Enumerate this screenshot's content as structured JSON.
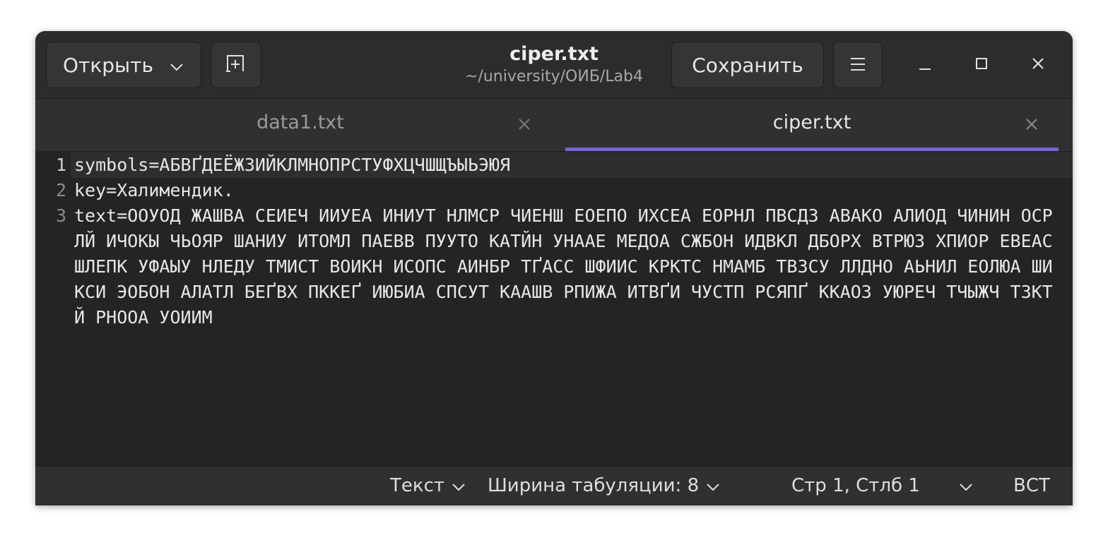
{
  "header": {
    "open_label": "Открыть",
    "title": "ciper.txt",
    "subtitle": "~/university/ОИБ/Lab4",
    "save_label": "Сохранить"
  },
  "tabs": [
    {
      "label": "data1.txt",
      "active": false
    },
    {
      "label": "ciper.txt",
      "active": true
    }
  ],
  "editor": {
    "line_numbers": [
      "1",
      "2",
      "3"
    ],
    "lines": [
      "symbols=АБВҐДЕЁЖЗИЙКЛМНОПРСТУФХЦЧШЩЪЫЬЭЮЯ",
      "key=Халимендик.",
      "text=ООУОД ЖАШВА СЕИЕЧ ИИУЕА ИНИУТ НЛМСР ЧИЕНШ ЕОЕПО ИХСЕА ЕОРНЛ ПВСДЗ АВАКО АЛИОД ЧИНИН ОСРЛЙ ИЧОКЫ ЧЬОЯР ШАНИУ ИТОМЛ ПАЕВВ ПУУТО КАТЙН УНААЕ МЕДОА СЖБОН ИДВКЛ ДБОРХ ВТРЮЗ ХПИОР ЕВЕАС ШЛЕПК УФАЫУ НЛЕДУ ТМИСТ ВОИКН ИСОПС АИНБР ТҐАСС ШФИИС КРКТС НМАМБ ТВЗСУ ЛЛДНО АЬНИЛ ЕОЛЮА ШИКСИ ЭОБОН АЛАТЛ БЕҐВХ ПККЕҐ ИЮБИА СПСУТ КААШВ РПИЖА ИТВҐИ ЧУСТП РСЯПҐ ККАОЗ УЮРЕЧ ТЧЫЖЧ ТЗКТЙ РНООА УОИИМ"
    ]
  },
  "statusbar": {
    "syntax_label": "Текст",
    "tab_width_label": "Ширина табуляции: 8",
    "position_label": "Стр 1, Стлб 1",
    "insert_mode": "ВСТ"
  },
  "colors": {
    "accent": "#7762d8",
    "window_bg": "#242424",
    "header_bg": "#2c2c2c"
  }
}
